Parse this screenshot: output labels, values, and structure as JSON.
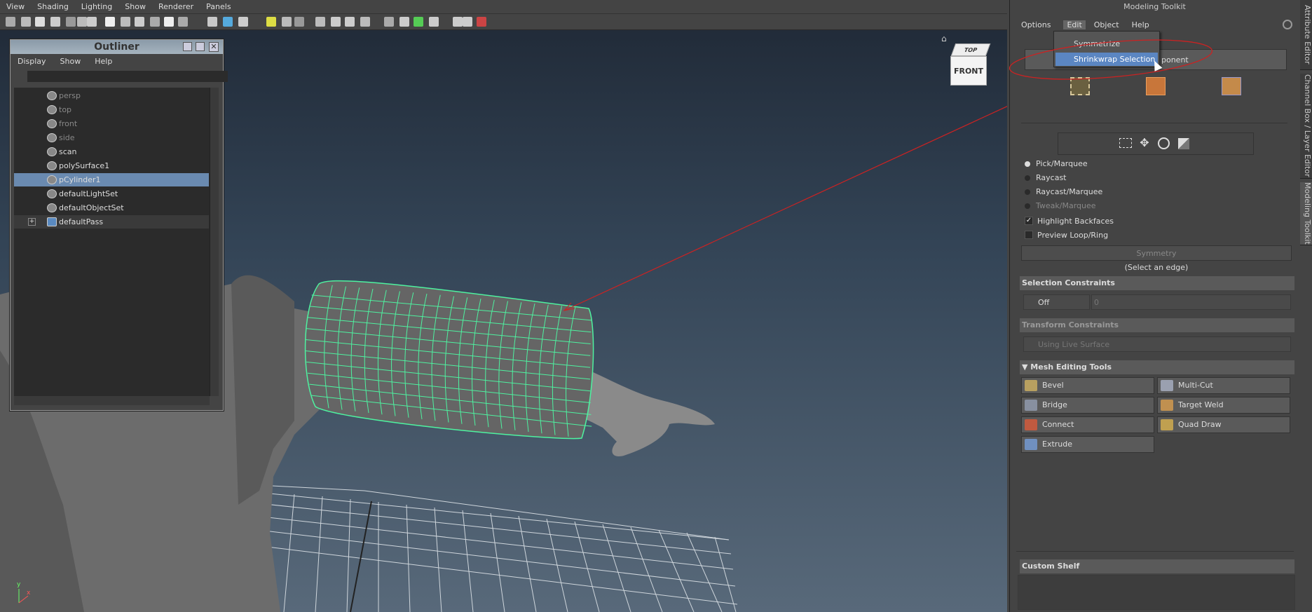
{
  "viewport": {
    "menu": [
      "View",
      "Shading",
      "Lighting",
      "Show",
      "Renderer",
      "Panels"
    ],
    "viewcube": {
      "top": "TOP",
      "front": "FRONT"
    },
    "axis": {
      "y": "y",
      "x": "x"
    }
  },
  "outliner": {
    "title": "Outliner",
    "menu": [
      "Display",
      "Show",
      "Help"
    ],
    "items": [
      {
        "label": "persp",
        "state": "dim"
      },
      {
        "label": "top",
        "state": "dim"
      },
      {
        "label": "front",
        "state": "dim"
      },
      {
        "label": "side",
        "state": "dim"
      },
      {
        "label": "scan",
        "state": "normal"
      },
      {
        "label": "polySurface1",
        "state": "normal"
      },
      {
        "label": "pCylinder1",
        "state": "selected"
      },
      {
        "label": "defaultLightSet",
        "state": "normal"
      },
      {
        "label": "defaultObjectSet",
        "state": "normal"
      },
      {
        "label": "defaultPass",
        "state": "group"
      }
    ]
  },
  "toolkit": {
    "title": "Modeling Toolkit",
    "menu": [
      "Options",
      "Edit",
      "Object",
      "Help"
    ],
    "active_menu": "Edit",
    "edit_menu": [
      "Symmetrize",
      "Shrinkwrap Selection"
    ],
    "component_btn_partial": "ponent",
    "selection_modes": [
      "Pick/Marquee",
      "Raycast",
      "Raycast/Marquee",
      "Tweak/Marquee"
    ],
    "selected_mode": "Pick/Marquee",
    "highlight_backfaces": "Highlight Backfaces",
    "highlight_backfaces_checked": true,
    "preview_loop": "Preview Loop/Ring",
    "preview_loop_checked": false,
    "symmetry": "Symmetry",
    "select_edge_hint": "(Select an edge)",
    "selection_constraints": {
      "title": "Selection Constraints",
      "value": "Off",
      "number": "0"
    },
    "transform_constraints": {
      "title": "Transform Constraints",
      "value": "Using Live Surface"
    },
    "mesh_editing": {
      "title": "Mesh Editing Tools",
      "tools": [
        "Bevel",
        "Multi-Cut",
        "Bridge",
        "Target Weld",
        "Connect",
        "Quad Draw",
        "Extrude"
      ]
    },
    "custom_shelf": "Custom Shelf"
  },
  "side_tabs": [
    "Attribute Editor",
    "Channel Box / Layer Editor",
    "Modeling Toolkit"
  ]
}
